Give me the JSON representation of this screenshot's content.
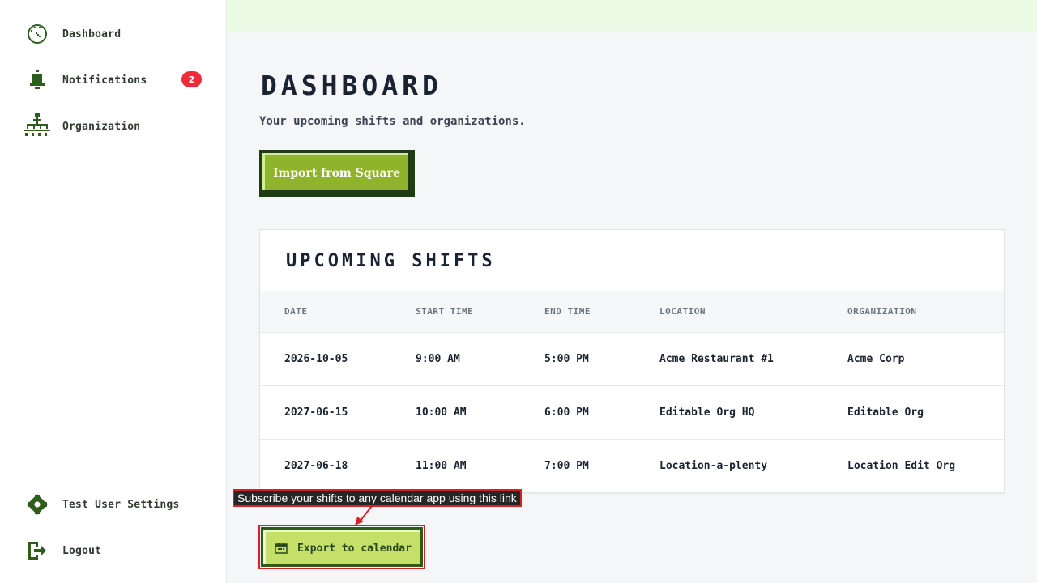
{
  "sidebar": {
    "items": [
      {
        "label": "Dashboard",
        "icon": "dashboard-gauge-icon"
      },
      {
        "label": "Notifications",
        "icon": "bell-icon",
        "badge": "2"
      },
      {
        "label": "Organization",
        "icon": "org-chart-icon"
      }
    ],
    "bottom_items": [
      {
        "label": "Test User Settings",
        "icon": "gear-icon"
      },
      {
        "label": "Logout",
        "icon": "logout-icon"
      }
    ]
  },
  "main": {
    "title": "Dashboard",
    "subtitle": "Your upcoming shifts and organizations.",
    "import_button": "Import from Square"
  },
  "shifts": {
    "title": "Upcoming Shifts",
    "columns": [
      "Date",
      "Start Time",
      "End Time",
      "Location",
      "Organization"
    ],
    "rows": [
      [
        "2026-10-05",
        "9:00 AM",
        "5:00 PM",
        "Acme Restaurant #1",
        "Acme Corp"
      ],
      [
        "2027-06-15",
        "10:00 AM",
        "6:00 PM",
        "Editable Org HQ",
        "Editable Org"
      ],
      [
        "2027-06-18",
        "11:00 AM",
        "7:00 PM",
        "Location-a-plenty",
        "Location Edit Org"
      ]
    ]
  },
  "tooltip": "Subscribe your shifts to any calendar app using this link",
  "export_button": "Export to calendar",
  "colors": {
    "accent_green": "#8fb32a",
    "dark_green": "#1f3d12",
    "light_green": "#c5e068",
    "badge_red": "#ee2b3a",
    "highlight_red": "#d62121"
  }
}
